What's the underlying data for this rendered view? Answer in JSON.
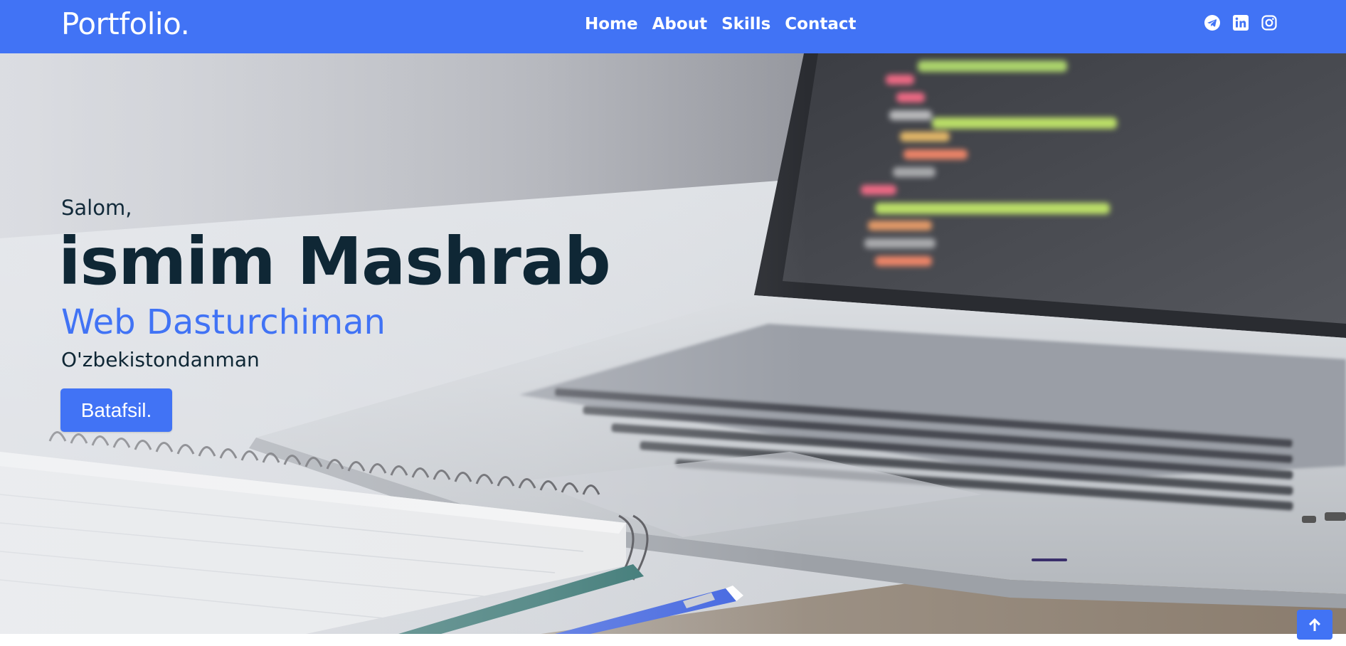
{
  "navbar": {
    "brand": "Portfolio.",
    "links": [
      {
        "label": "Home"
      },
      {
        "label": "About"
      },
      {
        "label": "Skills"
      },
      {
        "label": "Contact"
      }
    ],
    "social": [
      {
        "icon": "telegram-icon"
      },
      {
        "icon": "linkedin-icon"
      },
      {
        "icon": "instagram-icon"
      }
    ]
  },
  "hero": {
    "greeting": "Salom,",
    "name": "ismim Mashrab",
    "role": "Web Dasturchiman",
    "origin": "O'zbekistondanman",
    "button_label": "Batafsil."
  },
  "scroll_top": {
    "icon": "arrow-up-icon"
  },
  "colors": {
    "accent": "#4173f5",
    "heading": "#0f2735"
  }
}
